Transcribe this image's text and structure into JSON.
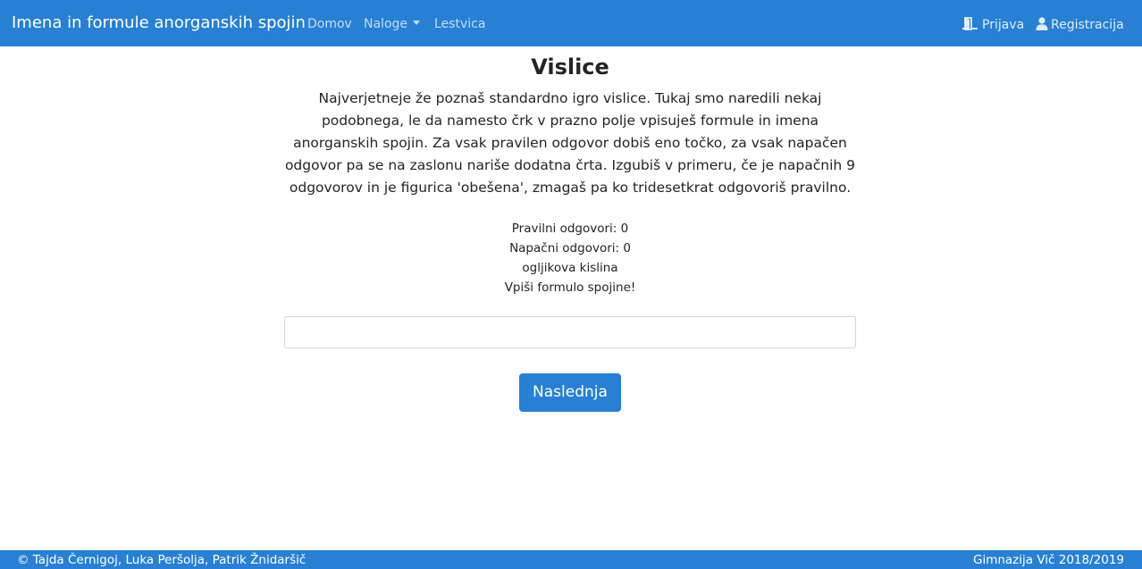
{
  "navbar": {
    "brand": "Imena in formule anorganskih spojin",
    "links": [
      {
        "label": "Domov"
      },
      {
        "label": "Naloge"
      },
      {
        "label": "Lestvica"
      }
    ],
    "right": [
      {
        "label": "Prijava",
        "icon": "sign-in-icon"
      },
      {
        "label": "Registracija",
        "icon": "user-icon"
      }
    ]
  },
  "main": {
    "title": "Vislice",
    "intro": "Najverjetneje že poznaš standardno igro vislice. Tukaj smo naredili nekaj podobnega, le da namesto črk v prazno polje vpisuješ formule in imena anorganskih spojin. Za vsak pravilen odgovor dobiš eno točko, za vsak napačen odgovor pa se na zaslonu nariše dodatna črta. Izgubiš v primeru, če je napačnih 9 odgovorov in je figurica 'obešena', zmagaš pa ko tridesetkrat odgovoriš pravilno.",
    "correct": "Pravilni odgovori: 0",
    "wrong": "Napačni odgovori: 0",
    "compound": "ogljikova kislina",
    "instruction": "Vpiši formulo spojine!",
    "answer_value": "",
    "next_label": "Naslednja"
  },
  "footer": {
    "left": "© Tajda Černigoj, Luka Peršolja, Patrik Žnidaršič",
    "right": "Gimnazija Vič 2018/2019"
  },
  "colors": {
    "primary": "#2780d4",
    "text": "#212529"
  }
}
